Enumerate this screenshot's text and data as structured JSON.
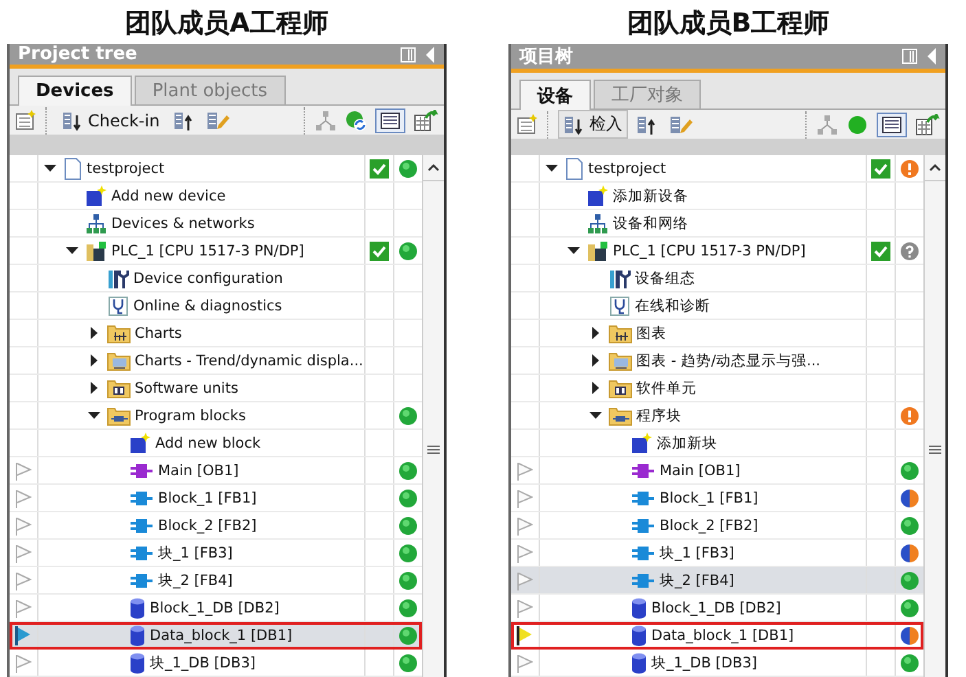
{
  "panels": [
    {
      "heading": "团队成员A工程师",
      "title": "Project tree",
      "tabs": [
        {
          "label": "Devices",
          "selected": true
        },
        {
          "label": "Plant objects",
          "selected": false
        }
      ],
      "toolbar": {
        "checkin": {
          "label": "Check-in",
          "pressed": false
        },
        "status_icon": {
          "kind": "sync"
        }
      },
      "items": [
        {
          "label": "testproject",
          "kind": "project",
          "expanded": true,
          "checked": true,
          "status": {
            "kind": "ok"
          },
          "selected": false,
          "marked": false,
          "children": [
            {
              "label": "Add new device",
              "kind": "add-device",
              "checked": false,
              "selected": false,
              "marked": false
            },
            {
              "label": "Devices & networks",
              "kind": "network",
              "checked": false,
              "selected": false,
              "marked": false
            },
            {
              "label": "PLC_1 [CPU 1517-3 PN/DP]",
              "kind": "plc",
              "expanded": true,
              "checked": true,
              "status": {
                "kind": "ok"
              },
              "selected": false,
              "marked": false,
              "children": [
                {
                  "label": "Device configuration",
                  "kind": "device-config",
                  "checked": false,
                  "selected": false,
                  "marked": false
                },
                {
                  "label": "Online & diagnostics",
                  "kind": "diagnostics",
                  "checked": false,
                  "selected": false,
                  "marked": false
                },
                {
                  "label": "Charts",
                  "kind": "folder-chart",
                  "expanded": false,
                  "checked": false,
                  "selected": false,
                  "marked": false
                },
                {
                  "label": "Charts - Trend/dynamic displa...",
                  "kind": "folder-trend",
                  "expanded": false,
                  "checked": false,
                  "selected": false,
                  "marked": false
                },
                {
                  "label": "Software units",
                  "kind": "folder-units",
                  "expanded": false,
                  "checked": false,
                  "selected": false,
                  "marked": false
                },
                {
                  "label": "Program blocks",
                  "kind": "folder-blocks",
                  "expanded": true,
                  "checked": false,
                  "status": {
                    "kind": "ok"
                  },
                  "selected": false,
                  "marked": false,
                  "children": [
                    {
                      "label": "Add new block",
                      "kind": "add-block",
                      "checked": false,
                      "selected": false,
                      "marked": false
                    },
                    {
                      "label": "Main [OB1]",
                      "kind": "ob",
                      "checked": false,
                      "status": {
                        "kind": "ok"
                      },
                      "flag": {
                        "kind": "plain"
                      },
                      "selected": false,
                      "marked": false
                    },
                    {
                      "label": "Block_1 [FB1]",
                      "kind": "fb",
                      "checked": false,
                      "status": {
                        "kind": "ok"
                      },
                      "flag": {
                        "kind": "plain"
                      },
                      "selected": false,
                      "marked": false
                    },
                    {
                      "label": "Block_2 [FB2]",
                      "kind": "fb",
                      "checked": false,
                      "status": {
                        "kind": "ok"
                      },
                      "flag": {
                        "kind": "plain"
                      },
                      "selected": false,
                      "marked": false
                    },
                    {
                      "label": "块_1 [FB3]",
                      "kind": "fb",
                      "checked": false,
                      "status": {
                        "kind": "ok"
                      },
                      "flag": {
                        "kind": "plain"
                      },
                      "selected": false,
                      "marked": false
                    },
                    {
                      "label": "块_2 [FB4]",
                      "kind": "fb",
                      "checked": false,
                      "status": {
                        "kind": "ok"
                      },
                      "flag": {
                        "kind": "plain"
                      },
                      "selected": false,
                      "marked": false
                    },
                    {
                      "label": "Block_1_DB [DB2]",
                      "kind": "db",
                      "checked": false,
                      "status": {
                        "kind": "ok"
                      },
                      "flag": {
                        "kind": "plain"
                      },
                      "selected": false,
                      "marked": false
                    },
                    {
                      "label": "Data_block_1 [DB1]",
                      "kind": "db",
                      "checked": false,
                      "status": {
                        "kind": "ok"
                      },
                      "flag": {
                        "kind": "blue"
                      },
                      "selected": true,
                      "marked": true
                    },
                    {
                      "label": "块_1_DB [DB3]",
                      "kind": "db",
                      "checked": false,
                      "status": {
                        "kind": "ok"
                      },
                      "flag": {
                        "kind": "plain"
                      },
                      "selected": false,
                      "marked": false
                    }
                  ]
                }
              ]
            }
          ]
        }
      ]
    },
    {
      "heading": "团队成员B工程师",
      "title": "项目树",
      "tabs": [
        {
          "label": "设备",
          "selected": true
        },
        {
          "label": "工厂对象",
          "selected": false
        }
      ],
      "toolbar": {
        "checkin": {
          "label": "检入",
          "pressed": true
        },
        "status_icon": {
          "kind": "online"
        }
      },
      "items": [
        {
          "label": "testproject",
          "kind": "project",
          "expanded": true,
          "checked": true,
          "status": {
            "kind": "warning"
          },
          "selected": false,
          "marked": false,
          "children": [
            {
              "label": "添加新设备",
              "kind": "add-device",
              "checked": false,
              "selected": false,
              "marked": false
            },
            {
              "label": "设备和网络",
              "kind": "network",
              "checked": false,
              "selected": false,
              "marked": false
            },
            {
              "label": "PLC_1 [CPU 1517-3 PN/DP]",
              "kind": "plc",
              "expanded": true,
              "checked": true,
              "status": {
                "kind": "unknown"
              },
              "selected": false,
              "marked": false,
              "children": [
                {
                  "label": "设备组态",
                  "kind": "device-config",
                  "checked": false,
                  "selected": false,
                  "marked": false
                },
                {
                  "label": "在线和诊断",
                  "kind": "diagnostics",
                  "checked": false,
                  "selected": false,
                  "marked": false
                },
                {
                  "label": "图表",
                  "kind": "folder-chart",
                  "expanded": false,
                  "checked": false,
                  "selected": false,
                  "marked": false
                },
                {
                  "label": "图表 - 趋势/动态显示与强...",
                  "kind": "folder-trend",
                  "expanded": false,
                  "checked": false,
                  "selected": false,
                  "marked": false
                },
                {
                  "label": "软件单元",
                  "kind": "folder-units",
                  "expanded": false,
                  "checked": false,
                  "selected": false,
                  "marked": false
                },
                {
                  "label": "程序块",
                  "kind": "folder-blocks",
                  "expanded": true,
                  "checked": false,
                  "status": {
                    "kind": "warning"
                  },
                  "selected": false,
                  "marked": false,
                  "children": [
                    {
                      "label": "添加新块",
                      "kind": "add-block",
                      "checked": false,
                      "selected": false,
                      "marked": false
                    },
                    {
                      "label": "Main [OB1]",
                      "kind": "ob",
                      "checked": false,
                      "status": {
                        "kind": "ok"
                      },
                      "flag": {
                        "kind": "plain"
                      },
                      "selected": false,
                      "marked": false
                    },
                    {
                      "label": "Block_1 [FB1]",
                      "kind": "fb",
                      "checked": false,
                      "status": {
                        "kind": "mixed"
                      },
                      "flag": {
                        "kind": "plain"
                      },
                      "selected": false,
                      "marked": false
                    },
                    {
                      "label": "Block_2 [FB2]",
                      "kind": "fb",
                      "checked": false,
                      "status": {
                        "kind": "ok"
                      },
                      "flag": {
                        "kind": "plain"
                      },
                      "selected": false,
                      "marked": false
                    },
                    {
                      "label": "块_1 [FB3]",
                      "kind": "fb",
                      "checked": false,
                      "status": {
                        "kind": "mixed"
                      },
                      "flag": {
                        "kind": "plain"
                      },
                      "selected": false,
                      "marked": false
                    },
                    {
                      "label": "块_2 [FB4]",
                      "kind": "fb",
                      "checked": false,
                      "status": {
                        "kind": "ok"
                      },
                      "flag": {
                        "kind": "plain"
                      },
                      "selected": true,
                      "marked": false
                    },
                    {
                      "label": "Block_1_DB [DB2]",
                      "kind": "db",
                      "checked": false,
                      "status": {
                        "kind": "ok"
                      },
                      "flag": {
                        "kind": "plain"
                      },
                      "selected": false,
                      "marked": false
                    },
                    {
                      "label": "Data_block_1 [DB1]",
                      "kind": "db",
                      "checked": false,
                      "status": {
                        "kind": "mixed"
                      },
                      "flag": {
                        "kind": "yellow"
                      },
                      "selected": false,
                      "marked": true
                    },
                    {
                      "label": "块_1_DB [DB3]",
                      "kind": "db",
                      "checked": false,
                      "status": {
                        "kind": "ok"
                      },
                      "flag": {
                        "kind": "plain"
                      },
                      "selected": false,
                      "marked": false
                    }
                  ]
                }
              ]
            }
          ]
        }
      ]
    }
  ]
}
